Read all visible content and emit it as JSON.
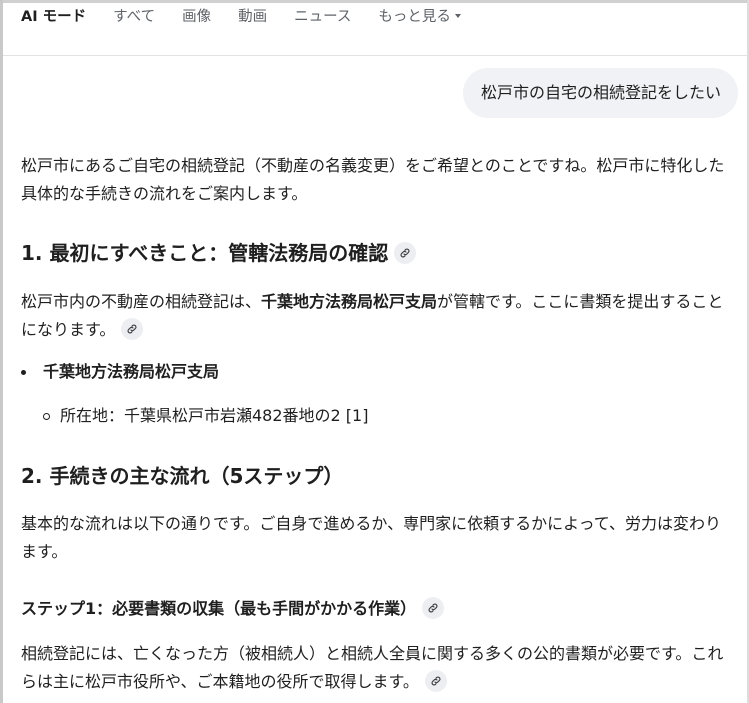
{
  "tabs": [
    {
      "label": "AI モード",
      "active": true
    },
    {
      "label": "すべて",
      "active": false
    },
    {
      "label": "画像",
      "active": false
    },
    {
      "label": "動画",
      "active": false
    },
    {
      "label": "ニュース",
      "active": false
    },
    {
      "label": "もっと見る",
      "active": false,
      "dropdown": true
    }
  ],
  "query": "松戸市の自宅の相続登記をしたい",
  "answer": {
    "intro": "松戸市にあるご自宅の相続登記（不動産の名義変更）をご希望とのことですね。松戸市に特化した具体的な手続きの流れをご案内します。",
    "section1": {
      "heading": "1. 最初にすべきこと：管轄法務局の確認",
      "text_before": "松戸市内の不動産の相続登記は、",
      "text_bold": "千葉地方法務局松戸支局",
      "text_after": "が管轄です。ここに書類を提出することになります。",
      "bullet": "千葉地方法務局松戸支局",
      "sub_bullet": "所在地：千葉県松戸市岩瀬482番地の2 [1]"
    },
    "section2": {
      "heading": "2. 手続きの主な流れ（5ステップ）",
      "text": "基本的な流れは以下の通りです。ご自身で進めるか、専門家に依頼するかによって、労力は変わります。",
      "step1_heading": "ステップ1：必要書類の収集（最も手間がかかる作業）",
      "step1_text": "相続登記には、亡くなった方（被相続人）と相続人全員に関する多くの公的書類が必要です。これらは主に松戸市役所や、ご本籍地の役所で取得します。"
    }
  },
  "colors": {
    "text": "#1f1f1f",
    "muted": "#5f6368",
    "bubble_bg": "#f0f2f5",
    "chip_bg": "#eceef1"
  },
  "icons": {
    "link": "link-icon",
    "caret": "chevron-down-icon"
  }
}
